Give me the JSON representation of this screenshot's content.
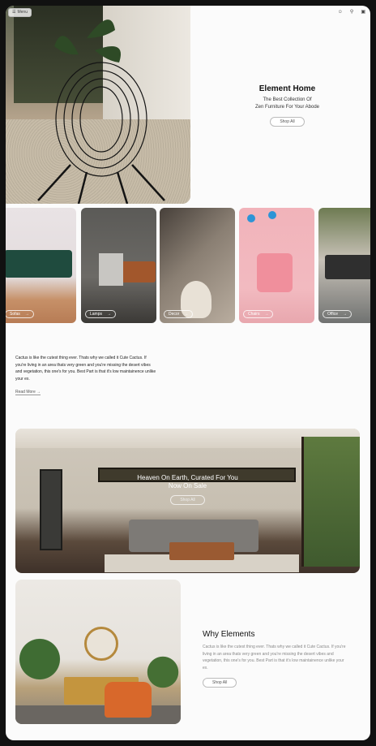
{
  "nav": {
    "menu_label": "Menu",
    "icons": [
      "user-icon",
      "search-icon",
      "cart-icon"
    ]
  },
  "hero": {
    "title": "Element Home",
    "subtitle_line1": "The Best Collection Of",
    "subtitle_line2": "Zen Furniture For Your Abode",
    "button": "Shop All"
  },
  "categories": [
    {
      "label": "Sofas"
    },
    {
      "label": "Lamps"
    },
    {
      "label": "Decor"
    },
    {
      "label": "Chairs"
    },
    {
      "label": "Office"
    }
  ],
  "about": {
    "text": "Cactus is like the cutest thing ever. Thats why we called it Cute Cactus. If you're living in an area thats very green and you're missing the desert vibes and vegetation, this one's for you. Best Part is that it's low maintainence unlike your ex.",
    "link": "Read More"
  },
  "banner": {
    "title_line1": "Heaven On Earth, Curated For You",
    "title_line2": "Now On Sale",
    "button": "Shop All"
  },
  "why": {
    "title": "Why Elements",
    "text": "Cactus is like the cutest thing ever. Thats why we called it Cute Cactus. If you're living in an area thats very green and you're missing the desert vibes and vegetation, this one's for you. Best Part is that it's low maintainence unlike your ex.",
    "button": "Shop All"
  }
}
